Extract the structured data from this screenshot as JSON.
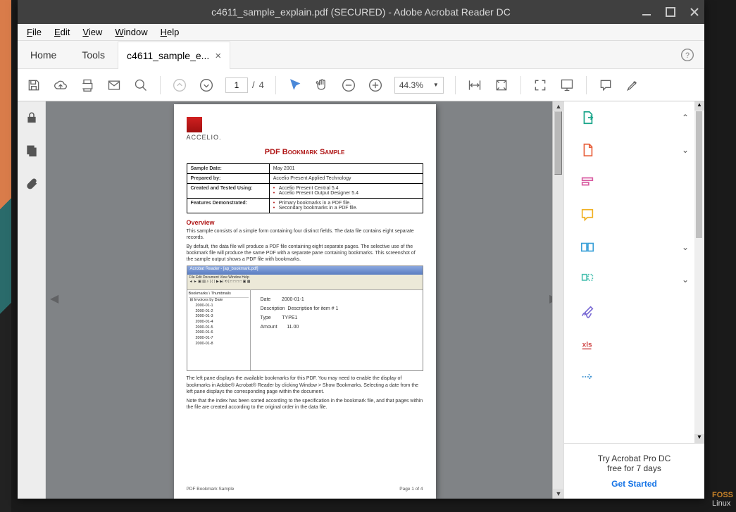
{
  "window": {
    "title": "c4611_sample_explain.pdf (SECURED) - Adobe Acrobat Reader DC"
  },
  "menubar": [
    "File",
    "Edit",
    "View",
    "Window",
    "Help"
  ],
  "tabs": {
    "home": "Home",
    "tools": "Tools",
    "doc": "c4611_sample_e..."
  },
  "toolbar": {
    "page_current": "1",
    "page_sep": "/",
    "page_total": "4",
    "zoom": "44.3%"
  },
  "doc": {
    "brand": "ACCELIO.",
    "title": "PDF Bookmark Sample",
    "table": {
      "r1": {
        "k": "Sample Date:",
        "v": "May 2001"
      },
      "r2": {
        "k": "Prepared by:",
        "v": "Accelio Present Applied Technology"
      },
      "r3": {
        "k": "Created and Tested Using:",
        "v1": "Accelio Present Central 5.4",
        "v2": "Accelio Present Output Designer 5.4"
      },
      "r4": {
        "k": "Features Demonstrated:",
        "v1": "Primary bookmarks in a PDF file.",
        "v2": "Secondary bookmarks in a PDF file."
      }
    },
    "h_overview": "Overview",
    "p1": "This sample consists of a simple form containing four distinct fields. The data file contains eight separate records.",
    "p2": "By default, the data file will produce a PDF file containing eight separate pages. The selective use of the bookmark file will produce the same PDF with a separate pane containing bookmarks. This screenshot of the sample output shows a PDF file with bookmarks.",
    "inset": {
      "title": "Acrobat Reader - [ap_bookmark.pdf]",
      "menu": "File Edit Document View Window Help",
      "tree_head": "Bookmarks \\ Thumbnails",
      "tree_root": "Invoices by Date",
      "dates": [
        "2000-01-1",
        "2000-01-2",
        "2000-01-3",
        "2000-01-4",
        "2000-01-5",
        "2000-01-6",
        "2000-01-7",
        "2000-01-8"
      ],
      "f1k": "Date",
      "f1v": "2000-01-1",
      "f2k": "Description",
      "f2v": "Description for item # 1",
      "f3k": "Type",
      "f3v": "TYPE1",
      "f4k": "Amount",
      "f4v": "11.00"
    },
    "p3": "The left pane displays the available bookmarks for this PDF. You may need to enable the display of bookmarks in Adobe® Acrobat® Reader by clicking Window > Show Bookmarks. Selecting a date from the left pane displays the corresponding page within the document.",
    "p4": "Note that the index has been sorted according to the specification in the bookmark file, and that pages within the file are created according to the original order in the data file.",
    "footer_l": "PDF Bookmark Sample",
    "footer_r": "Page 1 of 4"
  },
  "promo": {
    "l1": "Try Acrobat Pro DC",
    "l2": "free for 7 days",
    "cta": "Get Started"
  },
  "watermark": {
    "a": "FOSS",
    "b": "Linux"
  }
}
